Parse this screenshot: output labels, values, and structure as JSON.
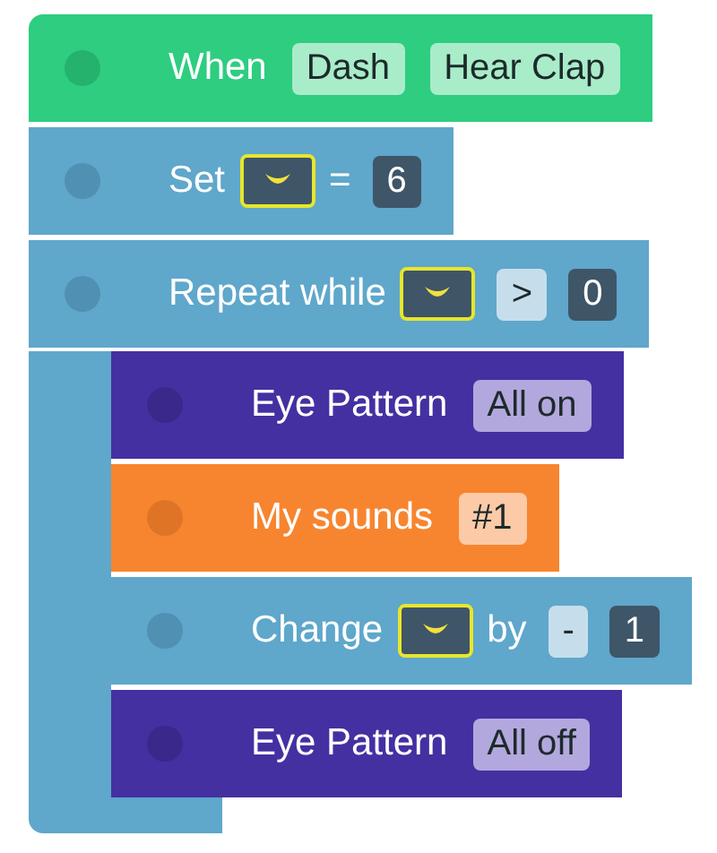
{
  "blocks": [
    {
      "kind": "event",
      "tokens": [
        {
          "kind": "text",
          "text": "When"
        },
        {
          "kind": "option",
          "text": "Dash"
        },
        {
          "kind": "option",
          "text": "Hear Clap"
        }
      ]
    },
    {
      "kind": "variable",
      "tokens": [
        {
          "kind": "text",
          "text": "Set"
        },
        {
          "kind": "variable"
        },
        {
          "kind": "text",
          "text": "="
        },
        {
          "kind": "number",
          "text": "6"
        }
      ]
    },
    {
      "kind": "repeat",
      "tokens": [
        {
          "kind": "text",
          "text": "Repeat while"
        },
        {
          "kind": "variable"
        },
        {
          "kind": "operator",
          "text": ">"
        },
        {
          "kind": "number",
          "text": "0"
        }
      ],
      "children": [
        {
          "kind": "look",
          "tokens": [
            {
              "kind": "text",
              "text": "Eye Pattern"
            },
            {
              "kind": "option",
              "text": "All on"
            }
          ]
        },
        {
          "kind": "sound",
          "tokens": [
            {
              "kind": "text",
              "text": "My sounds"
            },
            {
              "kind": "option",
              "text": "#1"
            }
          ]
        },
        {
          "kind": "variable",
          "tokens": [
            {
              "kind": "text",
              "text": "Change"
            },
            {
              "kind": "variable"
            },
            {
              "kind": "text",
              "text": "by"
            },
            {
              "kind": "operator",
              "text": "-"
            },
            {
              "kind": "number",
              "text": "1"
            }
          ]
        },
        {
          "kind": "look",
          "tokens": [
            {
              "kind": "text",
              "text": "Eye Pattern"
            },
            {
              "kind": "option",
              "text": "All off"
            }
          ]
        }
      ]
    }
  ]
}
